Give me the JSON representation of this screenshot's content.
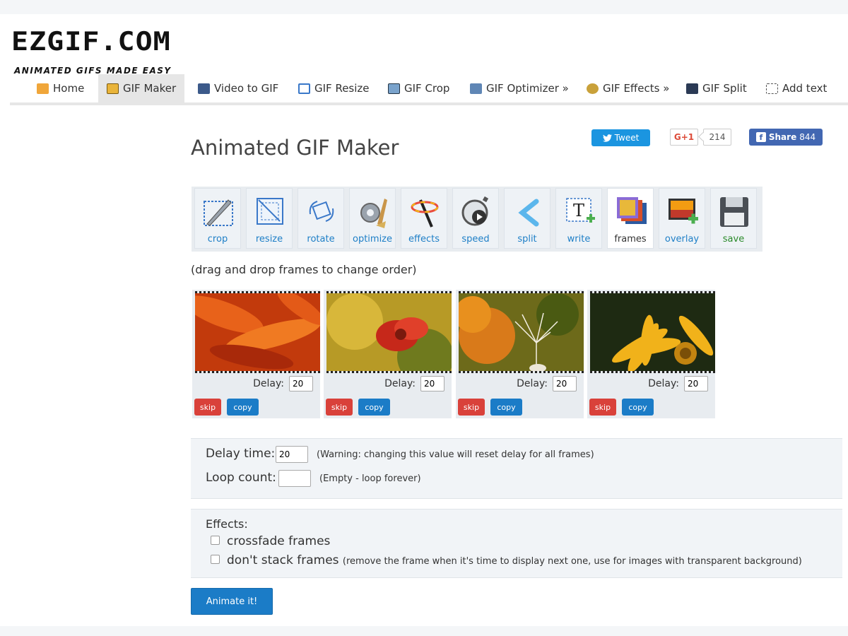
{
  "logo": {
    "main": "EZGIF.COM",
    "tagline": "ANIMATED GIFS MADE EASY"
  },
  "nav": {
    "items": [
      {
        "label": "Home",
        "icon": "home-icon"
      },
      {
        "label": "GIF Maker",
        "icon": "gif-maker-icon",
        "active": true
      },
      {
        "label": "Video to GIF",
        "icon": "film-icon"
      },
      {
        "label": "GIF Resize",
        "icon": "resize-icon"
      },
      {
        "label": "GIF Crop",
        "icon": "crop-icon"
      },
      {
        "label": "GIF Optimizer »",
        "icon": "optimizer-icon"
      },
      {
        "label": "GIF Effects »",
        "icon": "effects-icon"
      },
      {
        "label": "GIF Split",
        "icon": "split-icon"
      },
      {
        "label": "Add text",
        "icon": "add-text-icon"
      }
    ]
  },
  "page": {
    "title": "Animated GIF Maker",
    "hint": "(drag and drop frames to change order)"
  },
  "social": {
    "tweet": "Tweet",
    "gplus": "G+1",
    "gplus_count": "214",
    "fb_share": "Share",
    "fb_count": "844"
  },
  "toolbar": {
    "tools": [
      {
        "label": "crop"
      },
      {
        "label": "resize"
      },
      {
        "label": "rotate"
      },
      {
        "label": "optimize"
      },
      {
        "label": "effects"
      },
      {
        "label": "speed"
      },
      {
        "label": "split"
      },
      {
        "label": "write"
      },
      {
        "label": "frames",
        "active": true
      },
      {
        "label": "overlay"
      },
      {
        "label": "save"
      }
    ]
  },
  "frames": {
    "delay_label": "Delay:",
    "skip_label": "skip",
    "copy_label": "copy",
    "items": [
      {
        "delay": "20"
      },
      {
        "delay": "20"
      },
      {
        "delay": "20"
      },
      {
        "delay": "20"
      }
    ]
  },
  "settings": {
    "delay_time_label": "Delay time:",
    "delay_time_value": "20",
    "delay_time_note": "(Warning: changing this value will reset delay for all frames)",
    "loop_count_label": "Loop count:",
    "loop_count_value": "",
    "loop_count_note": "(Empty - loop forever)"
  },
  "effects": {
    "title": "Effects:",
    "crossfade": "crossfade frames",
    "dont_stack": "don't stack frames",
    "dont_stack_note": "(remove the frame when it's time to display next one, use for images with transparent background)"
  },
  "animate_button": "Animate it!",
  "colors": {
    "primary_blue": "#1b7cc7",
    "skip_red": "#d9413a",
    "twitter": "#1b95e0",
    "facebook": "#4267b2"
  }
}
